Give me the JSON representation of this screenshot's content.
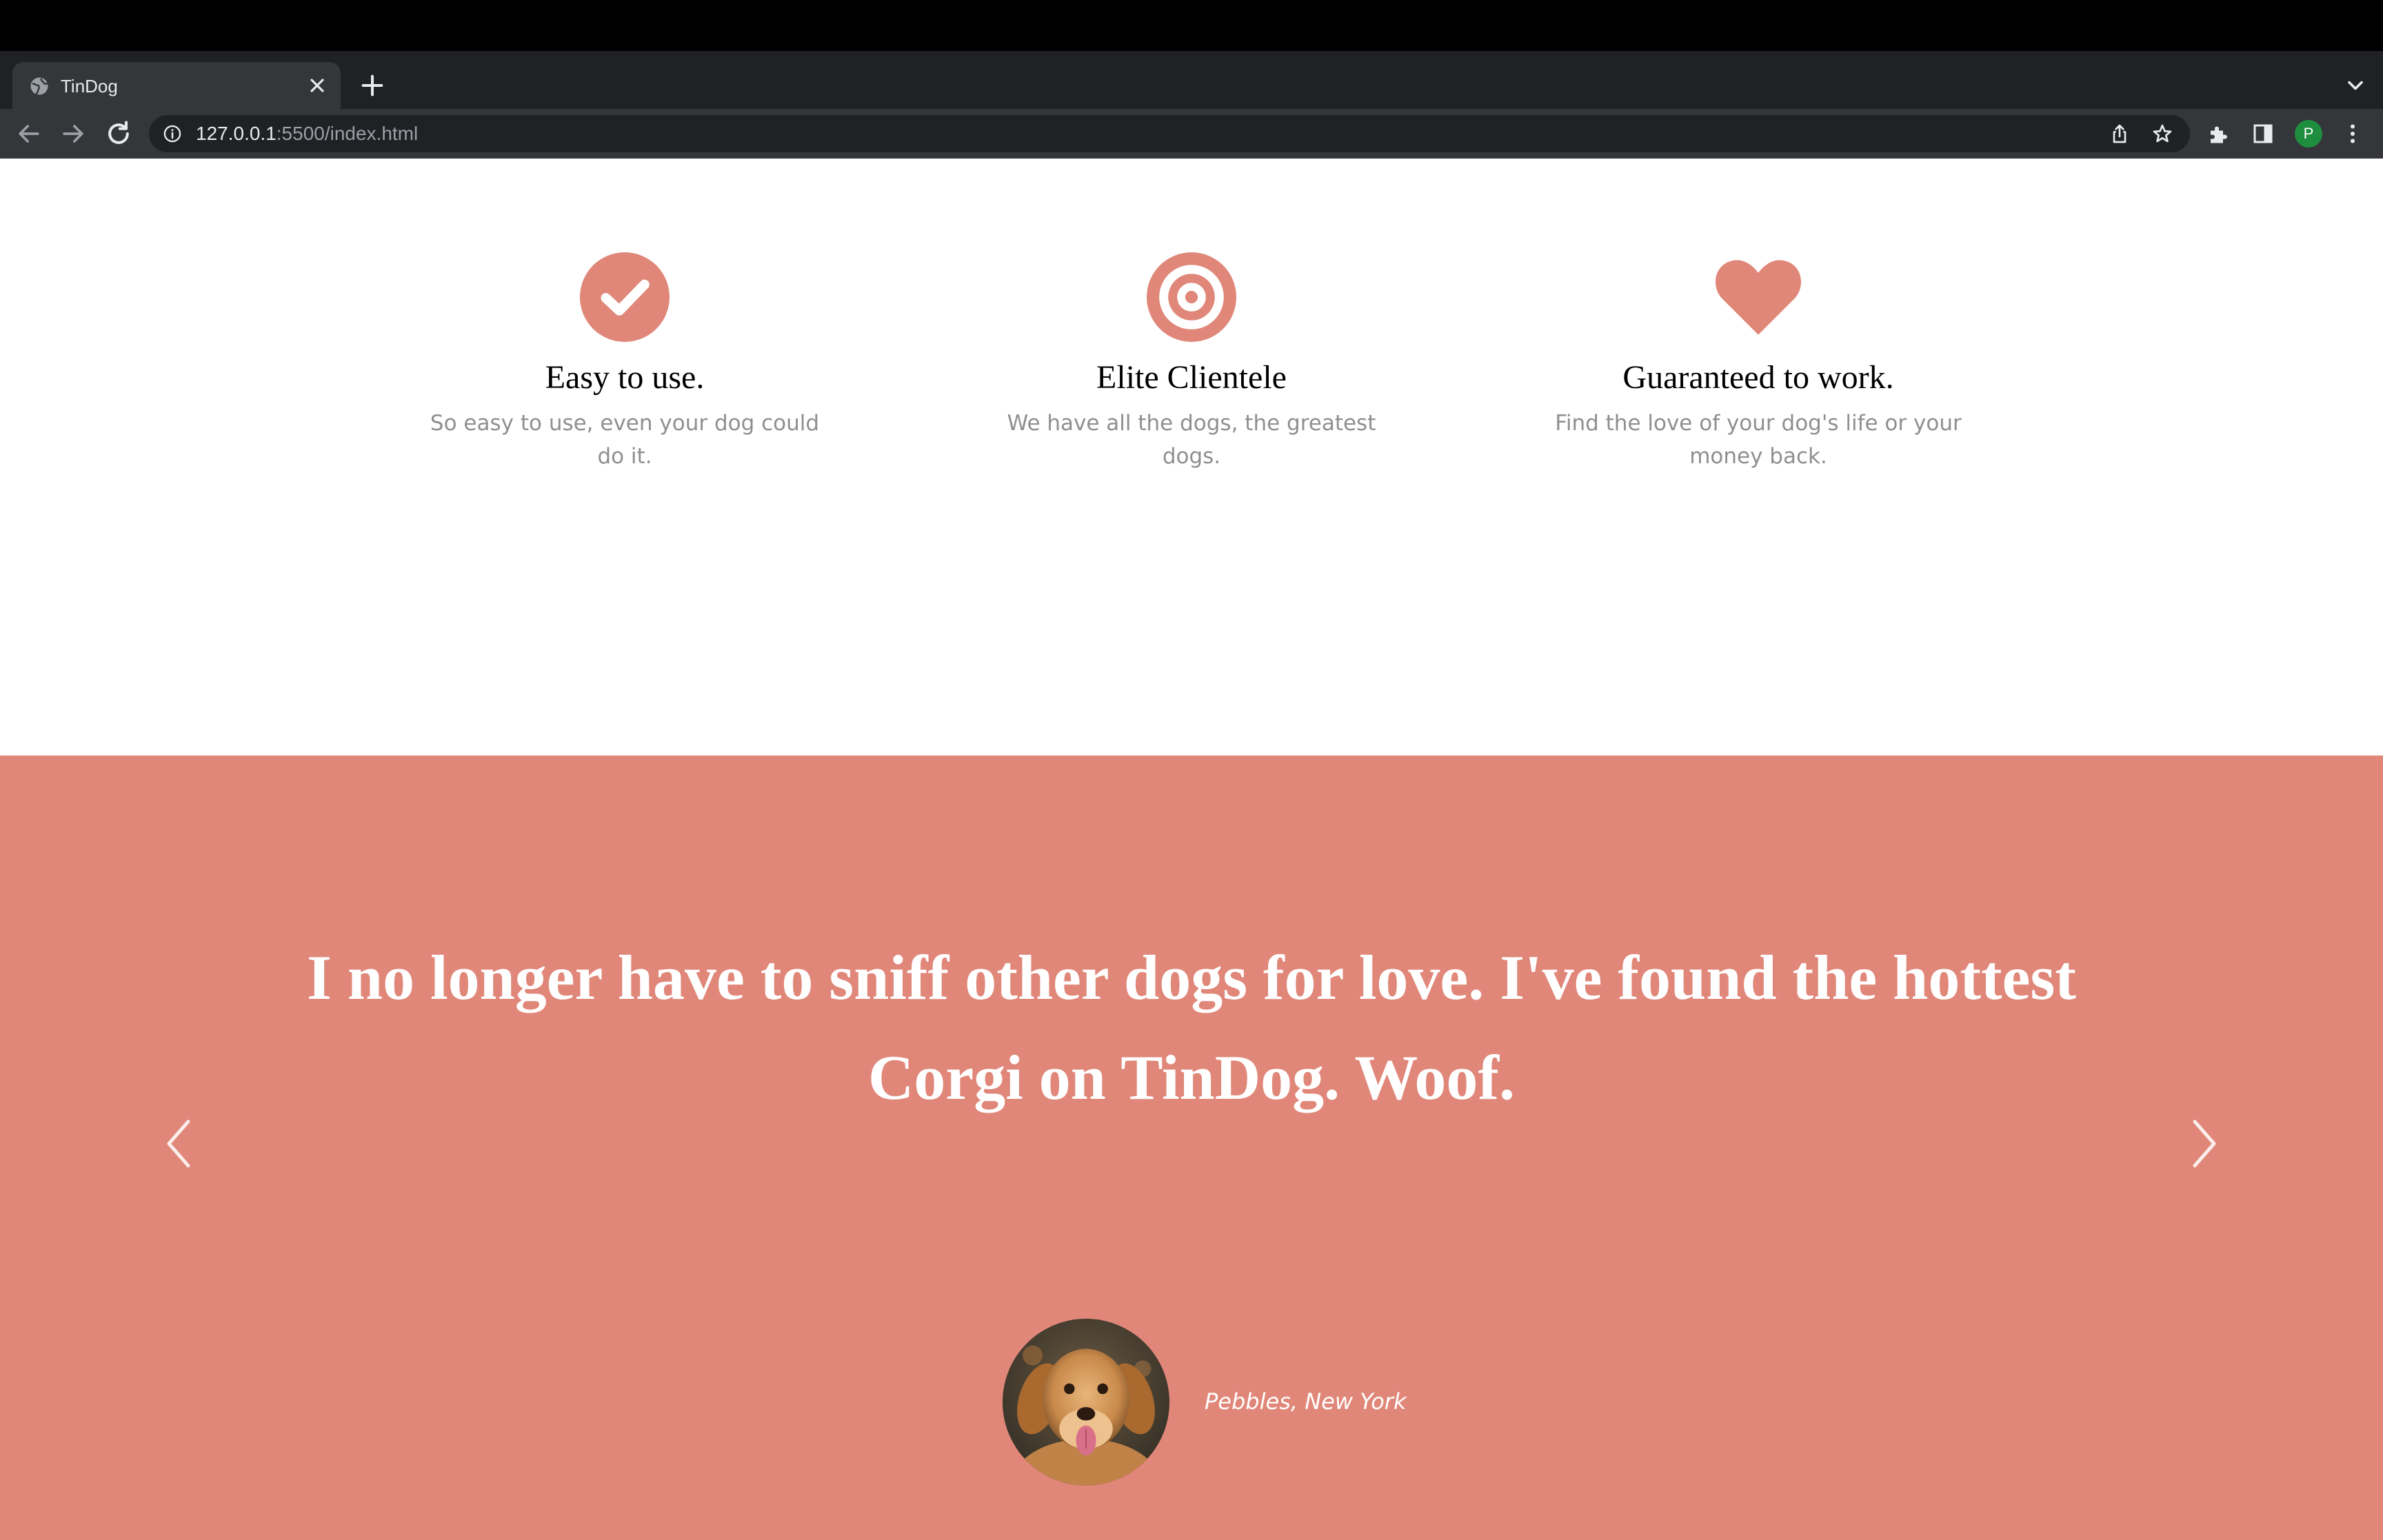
{
  "browser": {
    "tab_title": "TinDog",
    "url_host": "127.0.0.1",
    "url_rest": ":5500/index.html",
    "profile_initial": "P"
  },
  "features": [
    {
      "icon": "check-circle-icon",
      "title": "Easy to use.",
      "text": "So easy to use, even your dog could do it."
    },
    {
      "icon": "bullseye-icon",
      "title": "Elite Clientele",
      "text": "We have all the dogs, the greatest dogs."
    },
    {
      "icon": "heart-icon",
      "title": "Guaranteed to work.",
      "text": "Find the love of your dog's life or your money back."
    }
  ],
  "testimonial": {
    "quote": "I no longer have to sniff other dogs for love. I've found the hottest Corgi on TinDog. Woof.",
    "author": "Pebbles, New York"
  },
  "colors": {
    "accent": "#e08779",
    "chrome_dark": "#202124",
    "chrome_toolbar": "#35363a"
  }
}
